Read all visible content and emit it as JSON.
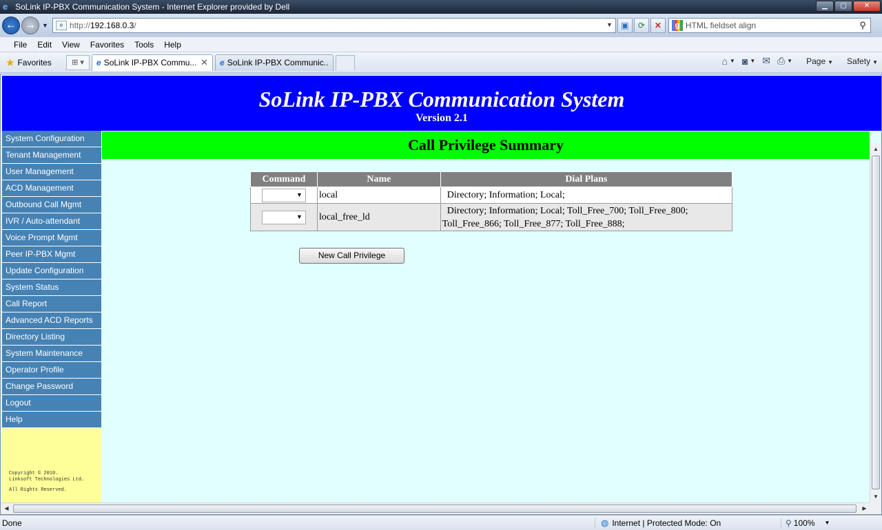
{
  "browser": {
    "window_title": "SoLink IP-PBX Communication System - Internet Explorer provided by Dell",
    "url_prefix": "http://",
    "url_host": "192.168.0.3",
    "url_suffix": "/",
    "search_text": "HTML fieldset align",
    "menu": [
      "File",
      "Edit",
      "View",
      "Favorites",
      "Tools",
      "Help"
    ],
    "favorites_label": "Favorites",
    "tabs": [
      {
        "label": "SoLink IP-PBX Commu..."
      },
      {
        "label": "SoLink IP-PBX Communic..."
      }
    ],
    "command_bar": {
      "page": "Page",
      "safety": "Safety"
    },
    "status": {
      "left": "Done",
      "zone": "Internet | Protected Mode: On",
      "zoom": "100%"
    }
  },
  "page": {
    "app_title": "SoLink IP-PBX Communication System",
    "version": "Version 2.1",
    "section_title": "Call Privilege Summary",
    "nav": [
      "System Configuration",
      "Tenant Management",
      "User Management",
      "ACD Management",
      "Outbound Call Mgmt",
      "IVR / Auto-attendant",
      "Voice Prompt Mgmt",
      "Peer IP-PBX Mgmt",
      "Update Configuration",
      "System Status",
      "Call Report",
      "Advanced ACD Reports",
      "Directory Listing",
      "System Maintenance",
      "Operator Profile",
      "Change Password",
      "Logout",
      "Help"
    ],
    "copyright": {
      "line1": "Copyright © 2010.",
      "line2": "Linksoft Technologies Ltd.",
      "line3": "All Rights Reserved."
    },
    "table": {
      "headers": [
        "Command",
        "Name",
        "Dial Plans"
      ],
      "rows": [
        {
          "command": "",
          "name": "local",
          "dial_plans": "Directory; Information; Local;"
        },
        {
          "command": "",
          "name": "local_free_ld",
          "dial_plans": "Directory; Information; Local; Toll_Free_700; Toll_Free_800; Toll_Free_866; Toll_Free_877; Toll_Free_888;"
        }
      ]
    },
    "new_button_label": "New Call Privilege"
  },
  "colors": {
    "header_bg": "#0000ff",
    "banner_bg": "#00ff00",
    "content_bg": "#e1ffff",
    "nav_bg": "#4682b4",
    "sidebar_bg": "#ffff99",
    "table_header_bg": "#808080"
  }
}
